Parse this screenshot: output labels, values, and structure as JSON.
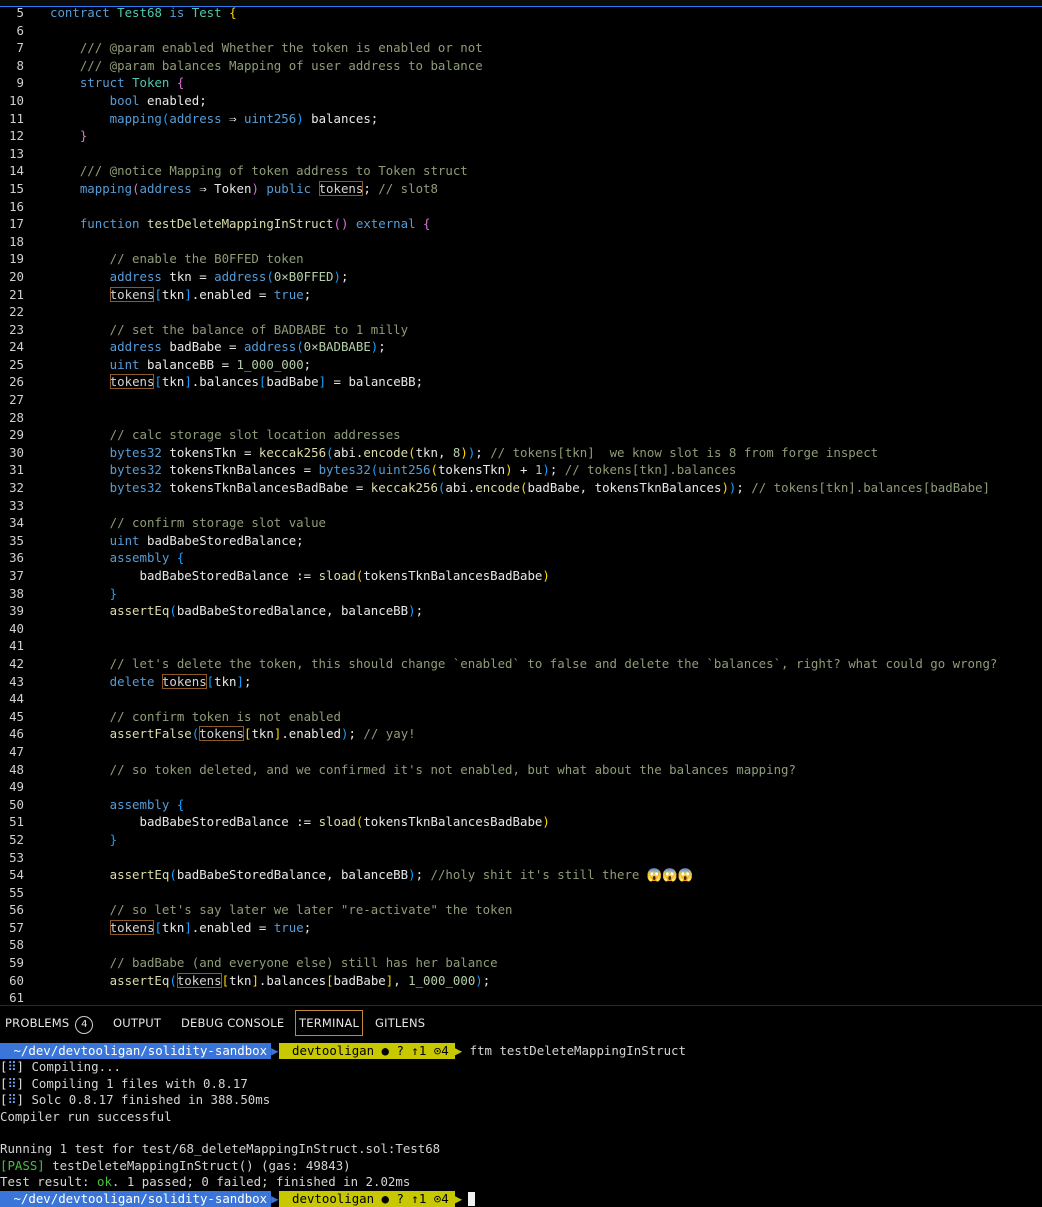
{
  "editor": {
    "lines": [
      {
        "n": "5",
        "segs": [
          [
            "k",
            "contract "
          ],
          [
            "t",
            "Test68"
          ],
          [
            "k",
            " is "
          ],
          [
            "t",
            "Test"
          ],
          [
            "n",
            " "
          ],
          [
            "p1",
            "{"
          ]
        ]
      },
      {
        "n": "6",
        "segs": []
      },
      {
        "n": "7",
        "segs": [
          [
            "c",
            "    /// @param enabled Whether the token is enabled or not"
          ]
        ]
      },
      {
        "n": "8",
        "segs": [
          [
            "c",
            "    /// @param balances Mapping of user address to balance"
          ]
        ]
      },
      {
        "n": "9",
        "segs": [
          [
            "k",
            "    struct "
          ],
          [
            "t",
            "Token "
          ],
          [
            "p2",
            "{"
          ]
        ]
      },
      {
        "n": "10",
        "segs": [
          [
            "k",
            "        bool "
          ],
          [
            "n",
            "enabled;"
          ]
        ]
      },
      {
        "n": "11",
        "segs": [
          [
            "k",
            "        mapping"
          ],
          [
            "p3",
            "("
          ],
          [
            "k",
            "address "
          ],
          [
            "n",
            "⇒ "
          ],
          [
            "k",
            "uint256"
          ],
          [
            "p3",
            ")"
          ],
          [
            "n",
            " balances;"
          ]
        ]
      },
      {
        "n": "12",
        "segs": [
          [
            "p2",
            "    }"
          ]
        ]
      },
      {
        "n": "13",
        "segs": []
      },
      {
        "n": "14",
        "segs": [
          [
            "c",
            "    /// @notice Mapping of token address to Token struct"
          ]
        ]
      },
      {
        "n": "15",
        "segs": [
          [
            "k",
            "    mapping"
          ],
          [
            "p2",
            "("
          ],
          [
            "k",
            "address "
          ],
          [
            "n",
            "⇒ Token"
          ],
          [
            "p2",
            ")"
          ],
          [
            "k",
            " public "
          ],
          [
            "hl",
            "tokens"
          ],
          [
            "n",
            "; "
          ],
          [
            "c",
            "// slot8"
          ]
        ]
      },
      {
        "n": "16",
        "segs": []
      },
      {
        "n": "17",
        "segs": [
          [
            "k",
            "    function "
          ],
          [
            "f",
            "testDeleteMappingInStruct"
          ],
          [
            "p2",
            "()"
          ],
          [
            "k",
            " external "
          ],
          [
            "p2",
            "{"
          ]
        ]
      },
      {
        "n": "18",
        "segs": []
      },
      {
        "n": "19",
        "segs": [
          [
            "c",
            "        // enable the B0FFED token"
          ]
        ]
      },
      {
        "n": "20",
        "segs": [
          [
            "k",
            "        address "
          ],
          [
            "n",
            "tkn = "
          ],
          [
            "k",
            "address"
          ],
          [
            "p3",
            "("
          ],
          [
            "num",
            "0×B0FFED"
          ],
          [
            "p3",
            ")"
          ],
          [
            "n",
            ";"
          ]
        ]
      },
      {
        "n": "21",
        "segs": [
          [
            "n",
            "        "
          ],
          [
            "hl",
            "tokens"
          ],
          [
            "p3",
            "["
          ],
          [
            "n",
            "tkn"
          ],
          [
            "p3",
            "]"
          ],
          [
            "n",
            ".enabled = "
          ],
          [
            "k",
            "true"
          ],
          [
            "n",
            ";"
          ]
        ]
      },
      {
        "n": "22",
        "segs": []
      },
      {
        "n": "23",
        "segs": [
          [
            "c",
            "        // set the balance of BADBABE to 1 milly"
          ]
        ]
      },
      {
        "n": "24",
        "segs": [
          [
            "k",
            "        address "
          ],
          [
            "n",
            "badBabe = "
          ],
          [
            "k",
            "address"
          ],
          [
            "p3",
            "("
          ],
          [
            "num",
            "0×BADBABE"
          ],
          [
            "p3",
            ")"
          ],
          [
            "n",
            ";"
          ]
        ]
      },
      {
        "n": "25",
        "segs": [
          [
            "k",
            "        uint "
          ],
          [
            "n",
            "balanceBB = "
          ],
          [
            "num",
            "1_000_000"
          ],
          [
            "n",
            ";"
          ]
        ]
      },
      {
        "n": "26",
        "segs": [
          [
            "n",
            "        "
          ],
          [
            "hl",
            "tokens"
          ],
          [
            "p3",
            "["
          ],
          [
            "n",
            "tkn"
          ],
          [
            "p3",
            "]"
          ],
          [
            "n",
            ".balances"
          ],
          [
            "p3",
            "["
          ],
          [
            "n",
            "badBabe"
          ],
          [
            "p3",
            "]"
          ],
          [
            "n",
            " = balanceBB;"
          ]
        ]
      },
      {
        "n": "27",
        "segs": []
      },
      {
        "n": "28",
        "segs": []
      },
      {
        "n": "29",
        "segs": [
          [
            "c",
            "        // calc storage slot location addresses"
          ]
        ]
      },
      {
        "n": "30",
        "segs": [
          [
            "k",
            "        bytes32 "
          ],
          [
            "n",
            "tokensTkn = "
          ],
          [
            "f",
            "keccak256"
          ],
          [
            "p3",
            "("
          ],
          [
            "n",
            "abi."
          ],
          [
            "f",
            "encode"
          ],
          [
            "p1",
            "("
          ],
          [
            "n",
            "tkn, "
          ],
          [
            "num",
            "8"
          ],
          [
            "p1",
            ")"
          ],
          [
            "p3",
            ")"
          ],
          [
            "n",
            "; "
          ],
          [
            "c",
            "// tokens[tkn]  we know slot is 8 from forge inspect"
          ]
        ]
      },
      {
        "n": "31",
        "segs": [
          [
            "k",
            "        bytes32 "
          ],
          [
            "n",
            "tokensTknBalances = "
          ],
          [
            "k",
            "bytes32"
          ],
          [
            "p3",
            "("
          ],
          [
            "k",
            "uint256"
          ],
          [
            "p1",
            "("
          ],
          [
            "n",
            "tokensTkn"
          ],
          [
            "p1",
            ")"
          ],
          [
            "n",
            " + "
          ],
          [
            "num",
            "1"
          ],
          [
            "p3",
            ")"
          ],
          [
            "n",
            "; "
          ],
          [
            "c",
            "// tokens[tkn].balances"
          ]
        ]
      },
      {
        "n": "32",
        "segs": [
          [
            "k",
            "        bytes32 "
          ],
          [
            "n",
            "tokensTknBalancesBadBabe = "
          ],
          [
            "f",
            "keccak256"
          ],
          [
            "p3",
            "("
          ],
          [
            "n",
            "abi."
          ],
          [
            "f",
            "encode"
          ],
          [
            "p1",
            "("
          ],
          [
            "n",
            "badBabe, tokensTknBalances"
          ],
          [
            "p1",
            ")"
          ],
          [
            "p3",
            ")"
          ],
          [
            "n",
            "; "
          ],
          [
            "c",
            "// tokens[tkn].balances[badBabe]"
          ]
        ]
      },
      {
        "n": "33",
        "segs": []
      },
      {
        "n": "34",
        "segs": [
          [
            "c",
            "        // confirm storage slot value"
          ]
        ]
      },
      {
        "n": "35",
        "segs": [
          [
            "k",
            "        uint "
          ],
          [
            "n",
            "badBabeStoredBalance;"
          ]
        ]
      },
      {
        "n": "36",
        "segs": [
          [
            "k",
            "        assembly "
          ],
          [
            "p3",
            "{"
          ]
        ]
      },
      {
        "n": "37",
        "segs": [
          [
            "n",
            "            badBabeStoredBalance := "
          ],
          [
            "f",
            "sload"
          ],
          [
            "p1",
            "("
          ],
          [
            "n",
            "tokensTknBalancesBadBabe"
          ],
          [
            "p1",
            ")"
          ]
        ]
      },
      {
        "n": "38",
        "segs": [
          [
            "p3",
            "        }"
          ]
        ]
      },
      {
        "n": "39",
        "segs": [
          [
            "f",
            "        assertEq"
          ],
          [
            "p3",
            "("
          ],
          [
            "n",
            "badBabeStoredBalance, balanceBB"
          ],
          [
            "p3",
            ")"
          ],
          [
            "n",
            ";"
          ]
        ]
      },
      {
        "n": "40",
        "segs": []
      },
      {
        "n": "41",
        "segs": []
      },
      {
        "n": "42",
        "segs": [
          [
            "c",
            "        // let's delete the token, this should change `enabled` to false and delete the `balances`, right? what could go wrong?"
          ]
        ]
      },
      {
        "n": "43",
        "segs": [
          [
            "k",
            "        delete "
          ],
          [
            "hl",
            "tokens"
          ],
          [
            "p3",
            "["
          ],
          [
            "n",
            "tkn"
          ],
          [
            "p3",
            "]"
          ],
          [
            "n",
            ";"
          ]
        ]
      },
      {
        "n": "44",
        "segs": []
      },
      {
        "n": "45",
        "segs": [
          [
            "c",
            "        // confirm token is not enabled"
          ]
        ]
      },
      {
        "n": "46",
        "segs": [
          [
            "f",
            "        assertFalse"
          ],
          [
            "p3",
            "("
          ],
          [
            "hl",
            "tokens"
          ],
          [
            "p1",
            "["
          ],
          [
            "n",
            "tkn"
          ],
          [
            "p1",
            "]"
          ],
          [
            "n",
            ".enabled"
          ],
          [
            "p3",
            ")"
          ],
          [
            "n",
            "; "
          ],
          [
            "c",
            "// yay!"
          ]
        ]
      },
      {
        "n": "47",
        "segs": []
      },
      {
        "n": "48",
        "segs": [
          [
            "c",
            "        // so token deleted, and we confirmed it's not enabled, but what about the balances mapping?"
          ]
        ]
      },
      {
        "n": "49",
        "segs": []
      },
      {
        "n": "50",
        "segs": [
          [
            "k",
            "        assembly "
          ],
          [
            "p3",
            "{"
          ]
        ]
      },
      {
        "n": "51",
        "segs": [
          [
            "n",
            "            badBabeStoredBalance := "
          ],
          [
            "f",
            "sload"
          ],
          [
            "p1",
            "("
          ],
          [
            "n",
            "tokensTknBalancesBadBabe"
          ],
          [
            "p1",
            ")"
          ]
        ]
      },
      {
        "n": "52",
        "segs": [
          [
            "p3",
            "        }"
          ]
        ]
      },
      {
        "n": "53",
        "segs": []
      },
      {
        "n": "54",
        "segs": [
          [
            "f",
            "        assertEq"
          ],
          [
            "p3",
            "("
          ],
          [
            "n",
            "badBabeStoredBalance, balanceBB"
          ],
          [
            "p3",
            ")"
          ],
          [
            "n",
            "; "
          ],
          [
            "c",
            "//holy shit it's still there 😱😱😱"
          ]
        ]
      },
      {
        "n": "55",
        "segs": []
      },
      {
        "n": "56",
        "segs": [
          [
            "c",
            "        // so let's say later we later \"re-activate\" the token"
          ]
        ]
      },
      {
        "n": "57",
        "segs": [
          [
            "n",
            "        "
          ],
          [
            "hl",
            "tokens"
          ],
          [
            "p3",
            "["
          ],
          [
            "n",
            "tkn"
          ],
          [
            "p3",
            "]"
          ],
          [
            "n",
            ".enabled = "
          ],
          [
            "k",
            "true"
          ],
          [
            "n",
            ";"
          ]
        ]
      },
      {
        "n": "58",
        "segs": []
      },
      {
        "n": "59",
        "segs": [
          [
            "c",
            "        // badBabe (and everyone else) still has her balance"
          ]
        ]
      },
      {
        "n": "60",
        "segs": [
          [
            "f",
            "        assertEq"
          ],
          [
            "p3",
            "("
          ],
          [
            "hl",
            "tokens"
          ],
          [
            "p1",
            "["
          ],
          [
            "n",
            "tkn"
          ],
          [
            "p1",
            "]"
          ],
          [
            "n",
            ".balances"
          ],
          [
            "p1",
            "["
          ],
          [
            "n",
            "badBabe"
          ],
          [
            "p1",
            "]"
          ],
          [
            "n",
            ", "
          ],
          [
            "num",
            "1_000_000"
          ],
          [
            "p3",
            ")"
          ],
          [
            "n",
            ";"
          ]
        ]
      },
      {
        "n": "61",
        "segs": []
      }
    ]
  },
  "panel": {
    "tabs": [
      {
        "label": "PROBLEMS",
        "badge": "4",
        "active": false
      },
      {
        "label": "OUTPUT",
        "active": false
      },
      {
        "label": "DEBUG CONSOLE",
        "active": false
      },
      {
        "label": "TERMINAL",
        "active": true
      },
      {
        "label": "GITLENS",
        "active": false
      }
    ]
  },
  "terminal": {
    "prompt_path": " ~/dev/devtooligan/solidity-sandbox",
    "prompt_git": " devtooligan ● ? ↑1 ⊙4",
    "command": "ftm testDeleteMappingInStruct",
    "compile_1": "Compiling...",
    "compile_2": "Compiling 1 files with 0.8.17",
    "compile_3": "Solc 0.8.17 finished in 388.50ms",
    "compile_status": "Compiler run successful",
    "running": "Running 1 test for test/68_deleteMappingInStruct.sol:Test68",
    "pass_tag": "[PASS]",
    "pass_text": " testDeleteMappingInStruct() (gas: 49843)",
    "result_prefix": "Test result: ",
    "result_ok": "ok",
    "result_rest": ". 1 passed; 0 failed; finished in 2.02ms",
    "prompt_path_2": " ~/dev/devtooligan/solidity-sandbox",
    "prompt_git_2": " devtooligan ● ? ↑1 ⊙4",
    "hash_mark": "⠿"
  }
}
